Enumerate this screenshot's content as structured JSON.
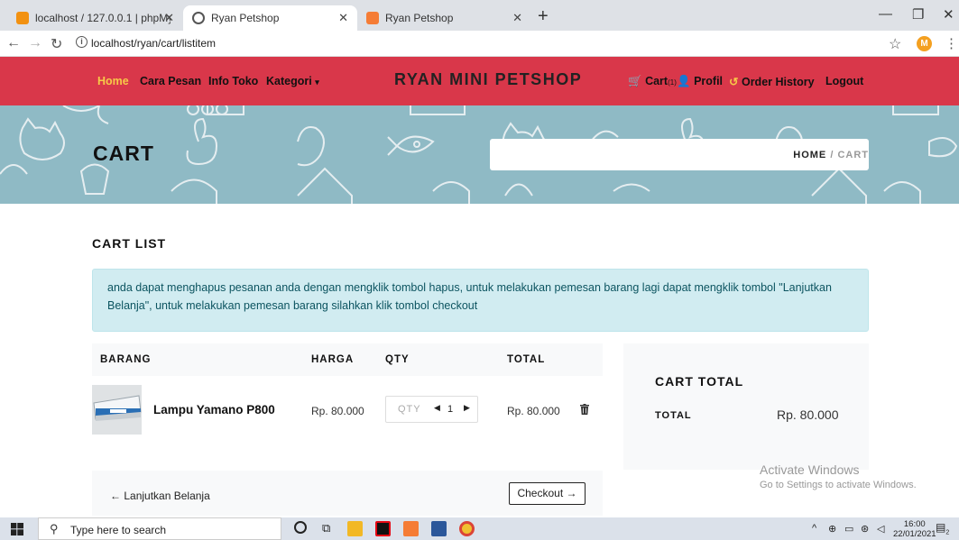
{
  "browser": {
    "tabs": [
      {
        "label": "localhost / 127.0.0.1 | phpMyAdm",
        "active": false
      },
      {
        "label": "Ryan Petshop",
        "active": true
      },
      {
        "label": "Ryan Petshop",
        "active": false
      }
    ],
    "url": "localhost/ryan/cart/listitem",
    "profile_initial": "M"
  },
  "navbar": {
    "home": "Home",
    "cara_pesan": "Cara Pesan",
    "info_toko": "Info Toko",
    "kategori": "Kategori",
    "brand": "RYAN MINI PETSHOP",
    "cart": "Cart",
    "cart_count": "(1)",
    "profil": "Profil",
    "order_history": "Order History",
    "logout": "Logout"
  },
  "hero": {
    "title": "CART",
    "breadcrumb_home": "HOME",
    "breadcrumb_sep": "/",
    "breadcrumb_current": "CART"
  },
  "cart_list": {
    "title": "CART LIST",
    "alert": "anda dapat menghapus pesanan anda dengan mengklik tombol hapus, untuk melakukan pemesan barang lagi dapat mengklik tombol \"Lanjutkan Belanja\", untuk melakukan pemesan barang silahkan klik tombol checkout",
    "headers": {
      "barang": "BARANG",
      "harga": "HARGA",
      "qty": "QTY",
      "total": "TOTAL"
    },
    "items": [
      {
        "name": "Lampu Yamano P800",
        "price": "Rp. 80.000",
        "qty_placeholder": "QTY",
        "qty": "1",
        "total": "Rp. 80.000"
      }
    ],
    "continue_label": "Lanjutkan Belanja",
    "checkout_label": "Checkout"
  },
  "cart_total": {
    "title": "CART TOTAL",
    "label": "TOTAL",
    "value": "Rp. 80.000"
  },
  "watermark": {
    "line1": "Activate Windows",
    "line2": "Go to Settings to activate Windows."
  },
  "taskbar": {
    "search_placeholder": "Type here to search",
    "time": "16:00",
    "date": "22/01/2021",
    "notif_count": "2"
  },
  "colors": {
    "navbar": "#d9374a",
    "home_active": "#f7c948",
    "hero_bg": "#8fbac5",
    "alert_bg": "#d1ecf1"
  }
}
